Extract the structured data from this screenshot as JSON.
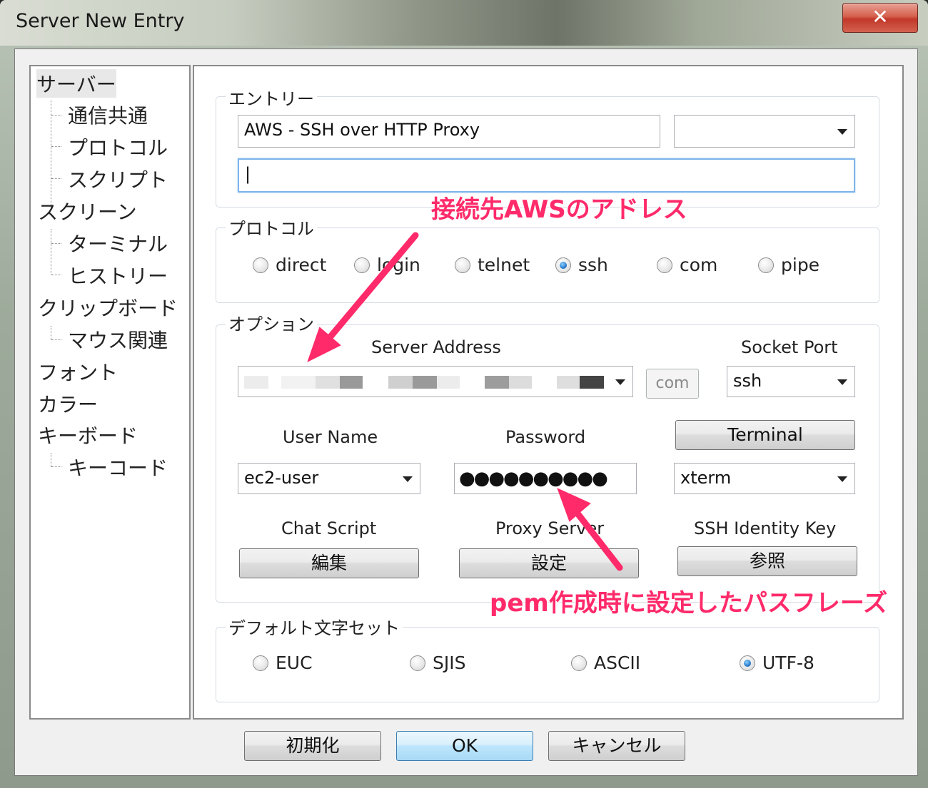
{
  "window": {
    "title": "Server New Entry",
    "close_glyph": "✕"
  },
  "sidebar": {
    "items": [
      {
        "label": "サーバー"
      },
      {
        "label": "通信共通"
      },
      {
        "label": "プロトコル"
      },
      {
        "label": "スクリプト"
      },
      {
        "label": "スクリーン"
      },
      {
        "label": "ターミナル"
      },
      {
        "label": "ヒストリー"
      },
      {
        "label": "クリップボード"
      },
      {
        "label": "マウス関連"
      },
      {
        "label": "フォント"
      },
      {
        "label": "カラー"
      },
      {
        "label": "キーボード"
      },
      {
        "label": "キーコード"
      }
    ]
  },
  "entry": {
    "group_label": "エントリー",
    "name_value": "AWS - SSH over HTTP Proxy",
    "group_select_value": "",
    "comment_value": "|"
  },
  "protocol": {
    "group_label": "プロトコル",
    "options": [
      "direct",
      "login",
      "telnet",
      "ssh",
      "com",
      "pipe"
    ],
    "selected": "ssh"
  },
  "options": {
    "group_label": "オプション",
    "server_address_label": "Server Address",
    "server_address_value": "",
    "com_button": "com",
    "socket_port_label": "Socket Port",
    "socket_port_value": "ssh",
    "user_name_label": "User Name",
    "user_name_value": "ec2-user",
    "password_label": "Password",
    "password_value": "●●●●●●●●●●",
    "terminal_button": "Terminal",
    "terminal_type_value": "xterm",
    "chat_script_label": "Chat Script",
    "chat_script_button": "編集",
    "proxy_server_label": "Proxy Server",
    "proxy_server_button": "設定",
    "ssh_key_label": "SSH Identity Key",
    "ssh_key_button": "参照"
  },
  "charset": {
    "group_label": "デフォルト文字セット",
    "options": [
      "EUC",
      "SJIS",
      "ASCII",
      "UTF-8"
    ],
    "selected": "UTF-8"
  },
  "footer": {
    "reset_button": "初期化",
    "ok_button": "OK",
    "cancel_button": "キャンセル"
  },
  "annotations": {
    "address_note": "接続先AWSのアドレス",
    "passphrase_note": "pem作成時に設定したパスフレーズ",
    "color": "#ff2a6a"
  }
}
